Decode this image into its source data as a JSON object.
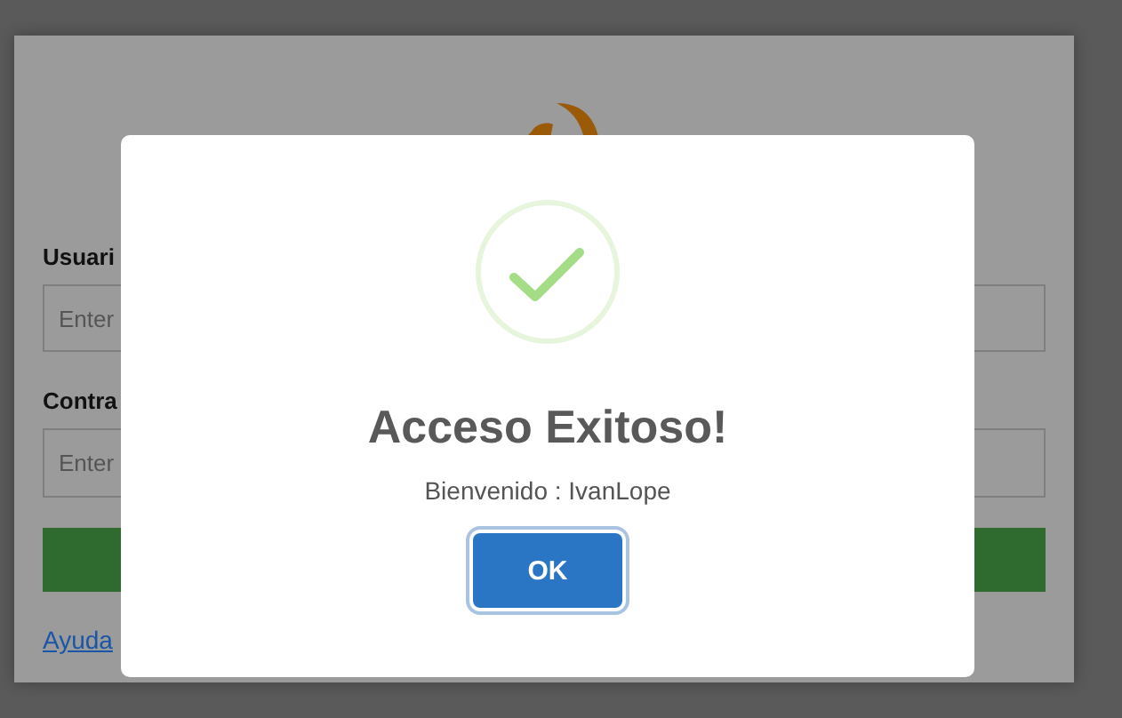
{
  "login_form": {
    "username_label": "Usuari",
    "username_placeholder": "Enter",
    "password_label": "Contra",
    "password_placeholder": "Enter",
    "help_link": "Ayuda"
  },
  "dialog": {
    "title": "Acceso Exitoso!",
    "message": "Bienvenido : IvanLope",
    "buttons": [
      {
        "label": "OK",
        "focused": true
      }
    ]
  }
}
